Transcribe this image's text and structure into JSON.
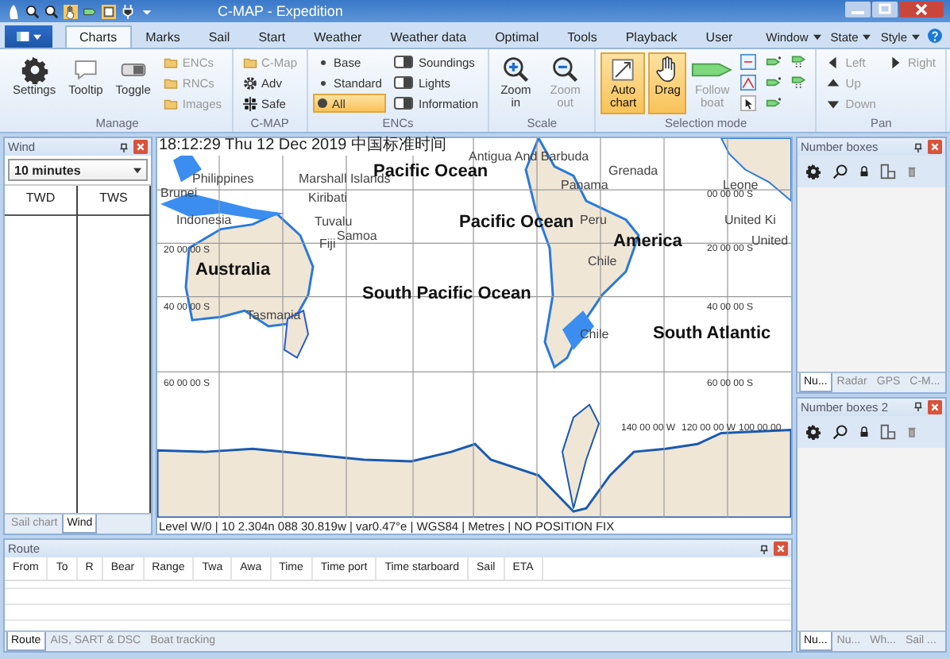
{
  "window": {
    "title": "C-MAP - Expedition"
  },
  "menu_tabs": [
    {
      "label": "Charts",
      "selected": true
    },
    {
      "label": "Marks",
      "selected": false
    },
    {
      "label": "Sail",
      "selected": false
    },
    {
      "label": "Start",
      "selected": false
    },
    {
      "label": "Weather",
      "selected": false
    },
    {
      "label": "Weather data",
      "selected": false
    },
    {
      "label": "Optimal",
      "selected": false
    },
    {
      "label": "Tools",
      "selected": false
    },
    {
      "label": "Playback",
      "selected": false
    },
    {
      "label": "User",
      "selected": false
    }
  ],
  "menu_right": [
    "Window",
    "State",
    "Style"
  ],
  "ribbon": {
    "groups": [
      {
        "label": "Manage",
        "items": [
          {
            "kind": "large",
            "label": "Settings",
            "disabled": false
          },
          {
            "kind": "large",
            "label": "Tooltip",
            "disabled": false
          },
          {
            "kind": "large",
            "label": "Toggle",
            "disabled": false
          },
          {
            "kind": "small",
            "label": "ENCs",
            "disabled": true
          },
          {
            "kind": "small",
            "label": "RNCs",
            "disabled": true
          },
          {
            "kind": "small",
            "label": "Images",
            "disabled": true
          }
        ]
      },
      {
        "label": "C-MAP",
        "items": [
          {
            "kind": "small",
            "label": "C-Map",
            "disabled": true
          },
          {
            "kind": "small",
            "label": "Adv",
            "disabled": false
          },
          {
            "kind": "small",
            "label": "Safe",
            "disabled": false
          }
        ]
      },
      {
        "label": "ENCs",
        "items": [
          {
            "kind": "radio",
            "label": "Base",
            "selected": false
          },
          {
            "kind": "radio",
            "label": "Standard",
            "selected": false
          },
          {
            "kind": "radio",
            "label": "All",
            "selected": true
          },
          {
            "kind": "switch",
            "label": "Soundings",
            "on": false
          },
          {
            "kind": "switch",
            "label": "Lights",
            "on": false
          },
          {
            "kind": "switch",
            "label": "Information",
            "on": false
          }
        ]
      },
      {
        "label": "Scale",
        "items": [
          {
            "kind": "large",
            "label": "Zoom in",
            "disabled": false
          },
          {
            "kind": "large",
            "label": "Zoom out",
            "disabled": true
          }
        ]
      },
      {
        "label": "Selection mode",
        "items": [
          {
            "kind": "large",
            "label": "Auto chart",
            "selected": true
          },
          {
            "kind": "large",
            "label": "Drag",
            "selected": true
          },
          {
            "kind": "large",
            "label": "Follow boat",
            "selected": false,
            "disabled": true
          },
          {
            "kind": "tool"
          },
          {
            "kind": "tool"
          },
          {
            "kind": "tool"
          },
          {
            "kind": "tool"
          },
          {
            "kind": "tool"
          },
          {
            "kind": "tool"
          },
          {
            "kind": "tool"
          },
          {
            "kind": "tool"
          }
        ]
      },
      {
        "label": "Pan",
        "items": [
          {
            "kind": "small",
            "label": "Left",
            "disabled": true
          },
          {
            "kind": "small",
            "label": "Up",
            "disabled": true
          },
          {
            "kind": "small",
            "label": "Down",
            "disabled": true
          },
          {
            "kind": "small",
            "label": "Right",
            "disabled": true
          }
        ]
      }
    ]
  },
  "wind_panel": {
    "title": "Wind",
    "interval": "10 minutes",
    "columns": [
      "TWD",
      "TWS"
    ],
    "tabs": [
      {
        "label": "Sail chart",
        "selected": false
      },
      {
        "label": "Wind",
        "selected": true
      }
    ]
  },
  "chart": {
    "timestamp": "18:12:29 Thu 12 Dec 2019 中国标准时间",
    "labels": [
      {
        "text": "Antigua And Barbuda",
        "kind": "place"
      },
      {
        "text": "Philippines",
        "kind": "place"
      },
      {
        "text": "Marshall Islands",
        "kind": "place"
      },
      {
        "text": "Pacific Ocean",
        "kind": "sea"
      },
      {
        "text": "Brunei",
        "kind": "place"
      },
      {
        "text": "Grenada",
        "kind": "place"
      },
      {
        "text": "Panama",
        "kind": "place"
      },
      {
        "text": "Leone",
        "kind": "place"
      },
      {
        "text": "Kiribati",
        "kind": "place"
      },
      {
        "text": "00 00 00 S",
        "kind": "coord"
      },
      {
        "text": "Indonesia",
        "kind": "place"
      },
      {
        "text": "Tuvalu",
        "kind": "place"
      },
      {
        "text": "Pacific Ocean",
        "kind": "sea"
      },
      {
        "text": "Peru",
        "kind": "place"
      },
      {
        "text": "United Ki",
        "kind": "place"
      },
      {
        "text": "Samoa",
        "kind": "place"
      },
      {
        "text": "Fiji",
        "kind": "place"
      },
      {
        "text": "America",
        "kind": "sea"
      },
      {
        "text": "United",
        "kind": "place"
      },
      {
        "text": "20 00 00 S",
        "kind": "coord"
      },
      {
        "text": "20 00 00 S",
        "kind": "coord"
      },
      {
        "text": "Australia",
        "kind": "sea"
      },
      {
        "text": "Chile",
        "kind": "place"
      },
      {
        "text": "South Pacific Ocean",
        "kind": "sea"
      },
      {
        "text": "40 00 00 S",
        "kind": "coord"
      },
      {
        "text": "Tasmania",
        "kind": "place"
      },
      {
        "text": "40 00 00 S",
        "kind": "coord"
      },
      {
        "text": "Chile",
        "kind": "place"
      },
      {
        "text": "South Atlantic",
        "kind": "sea"
      },
      {
        "text": "60 00 00 S",
        "kind": "coord"
      },
      {
        "text": "60 00 00 S",
        "kind": "coord"
      },
      {
        "text": "140 00 00 W",
        "kind": "coord"
      },
      {
        "text": "120 00 00 W",
        "kind": "coord"
      },
      {
        "text": "100 00 00",
        "kind": "coord"
      }
    ],
    "status": "Level W/0 | 10 2.304n 088 30.819w | var0.47°e | WGS84 | Metres | NO POSITION FIX"
  },
  "number_boxes": [
    {
      "title": "Number boxes",
      "tabs": [
        {
          "label": "Nu...",
          "selected": true
        },
        {
          "label": "Radar",
          "selected": false
        },
        {
          "label": "GPS",
          "selected": false
        },
        {
          "label": "C-M...",
          "selected": false
        }
      ]
    },
    {
      "title": "Number boxes 2",
      "tabs": [
        {
          "label": "Nu...",
          "selected": true
        },
        {
          "label": "Nu...",
          "selected": false
        },
        {
          "label": "Wh...",
          "selected": false
        },
        {
          "label": "Sail ...",
          "selected": false
        }
      ]
    }
  ],
  "route_panel": {
    "title": "Route",
    "columns": [
      "From",
      "To",
      "R",
      "Bear",
      "Range",
      "Twa",
      "Awa",
      "Time",
      "Time port",
      "Time starboard",
      "Sail",
      "ETA"
    ],
    "tabs": [
      {
        "label": "Route",
        "selected": true
      },
      {
        "label": "AIS, SART & DSC",
        "selected": false
      },
      {
        "label": "Boat tracking",
        "selected": false
      }
    ]
  }
}
